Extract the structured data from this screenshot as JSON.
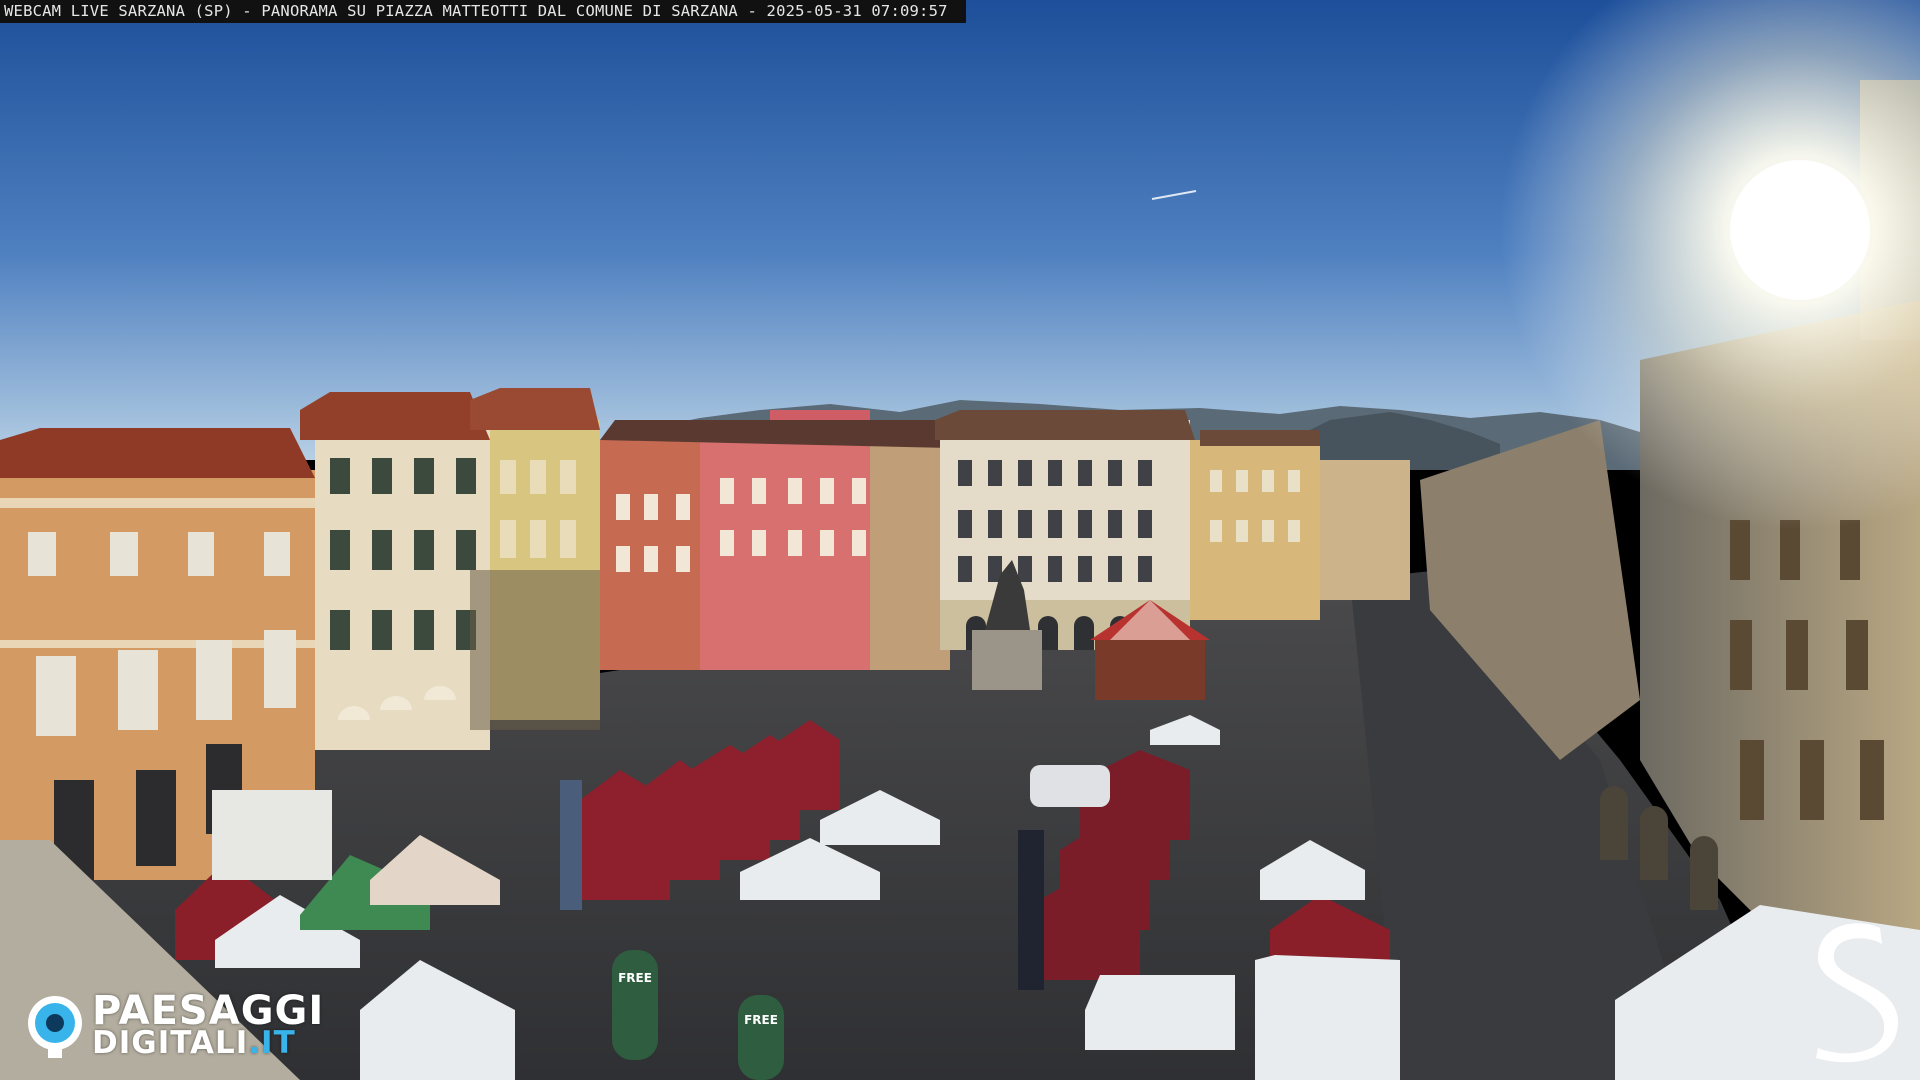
{
  "overlay": {
    "caption": "WEBCAM LIVE SARZANA (SP) - PANORAMA SU PIAZZA MATTEOTTI DAL COMUNE DI SARZANA - 2025-05-31  07:09:57"
  },
  "branding": {
    "paesaggi": "PAESAGGI",
    "digitali": "DIGITALI",
    "tld": ".IT",
    "accent_color": "#39b4ea"
  },
  "signs": {
    "banner_text": "FREE"
  },
  "palette": {
    "sky_top": "#1f5aa8",
    "sky_bottom": "#a9c6e0",
    "pavement": "#3b3c40",
    "tent_red": "#8e1f2c",
    "tent_white": "#e9ecef"
  }
}
